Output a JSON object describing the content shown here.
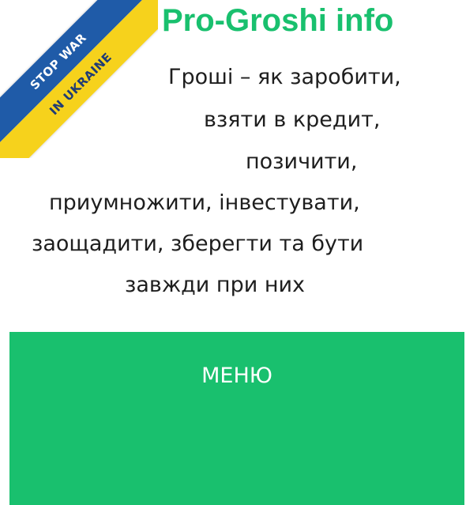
{
  "banner": {
    "line1": "STOP WAR",
    "line2": "IN UKRAINE",
    "colors": {
      "top": "#1f5ba8",
      "bottom": "#f6d21c"
    }
  },
  "header": {
    "site_title": "Pro-Groshi info",
    "tagline_lines": [
      "Гроші – як заробити,",
      "взяти в кредит,",
      "позичити,",
      "приумножити, інвестувати,",
      "заощадити, зберегти та бути",
      "завжди при них"
    ]
  },
  "menu": {
    "label": "МЕНЮ"
  },
  "colors": {
    "accent": "#19c06e",
    "text": "#1e1e1e"
  }
}
